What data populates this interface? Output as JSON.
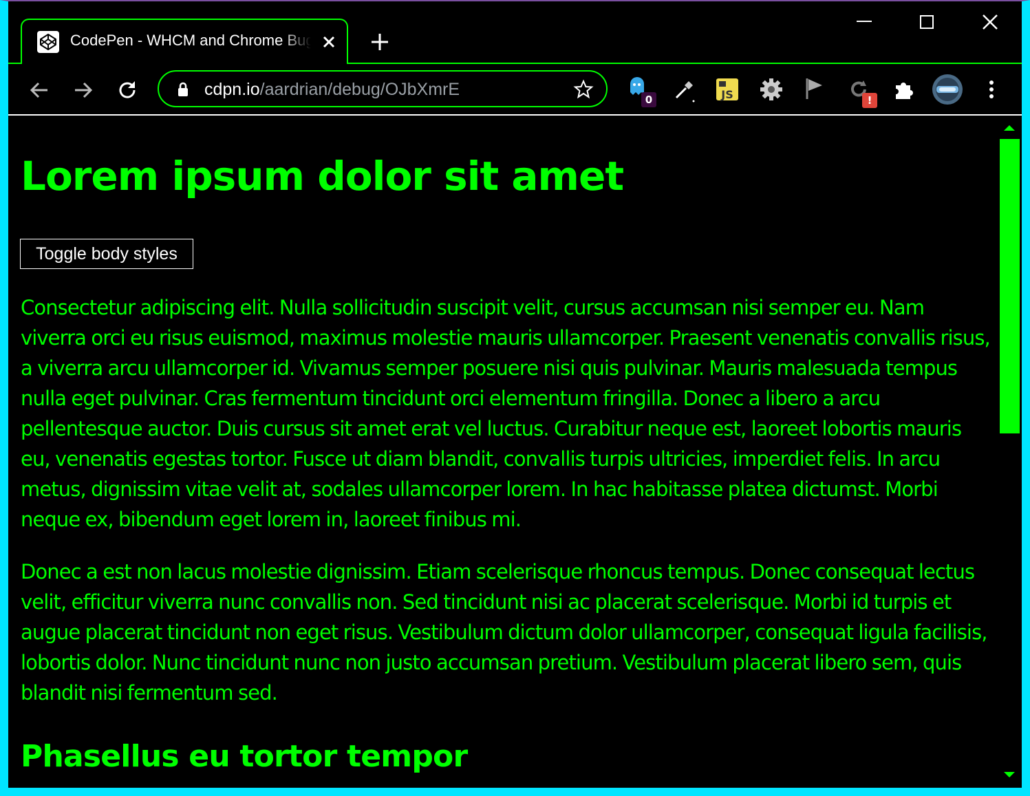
{
  "browser": {
    "tab_title": "CodePen - WHCM and Chrome Bug",
    "url_host": "cdpn.io",
    "url_path": "/aardrian/debug/OJbXmrE",
    "extension_badges": {
      "ghost": "0",
      "alert": "!"
    },
    "icons": [
      "codepen-icon",
      "close-icon",
      "plus-icon",
      "minimize-icon",
      "maximize-icon",
      "back-icon",
      "forward-icon",
      "reload-icon",
      "lock-icon",
      "star-icon",
      "ghostery-icon",
      "eyedropper-icon",
      "js-icon",
      "gear-icon",
      "flag-icon",
      "refresh-extension-icon",
      "puzzle-icon",
      "profile-avatar",
      "menu-icon"
    ]
  },
  "colors": {
    "frame": "#00e5ff",
    "accent": "#00ff00",
    "background": "#000000",
    "text": "#ffffff"
  },
  "page": {
    "heading": "Lorem ipsum dolor sit amet",
    "toggle_button": "Toggle body styles",
    "paragraphs": [
      "Consectetur adipiscing elit. Nulla sollicitudin suscipit velit, cursus accumsan nisi semper eu. Nam viverra orci eu risus euismod, maximus molestie mauris ullamcorper. Praesent venenatis convallis risus, a viverra arcu ullamcorper id. Vivamus semper posuere nisi quis pulvinar. Mauris malesuada tempus nulla eget pulvinar. Cras fermentum tincidunt orci elementum fringilla. Donec a libero a arcu pellentesque auctor. Duis cursus sit amet erat vel luctus. Curabitur neque est, laoreet lobortis mauris eu, venenatis egestas tortor. Fusce ut diam blandit, convallis turpis ultricies, imperdiet felis. In arcu metus, dignissim vitae velit at, sodales ullamcorper lorem. In hac habitasse platea dictumst. Morbi neque ex, bibendum eget lorem in, laoreet finibus mi.",
      "Donec a est non lacus molestie dignissim. Etiam scelerisque rhoncus tempus. Donec consequat lectus velit, efficitur viverra nunc convallis non. Sed tincidunt nisi ac placerat scelerisque. Morbi id turpis et augue placerat tincidunt non eget risus. Vestibulum dictum dolor ullamcorper, consequat ligula facilisis, lobortis dolor. Nunc tincidunt nunc non justo accumsan pretium. Vestibulum placerat libero sem, quis blandit nisi fermentum sed."
    ],
    "subheading": "Phasellus eu tortor tempor"
  }
}
